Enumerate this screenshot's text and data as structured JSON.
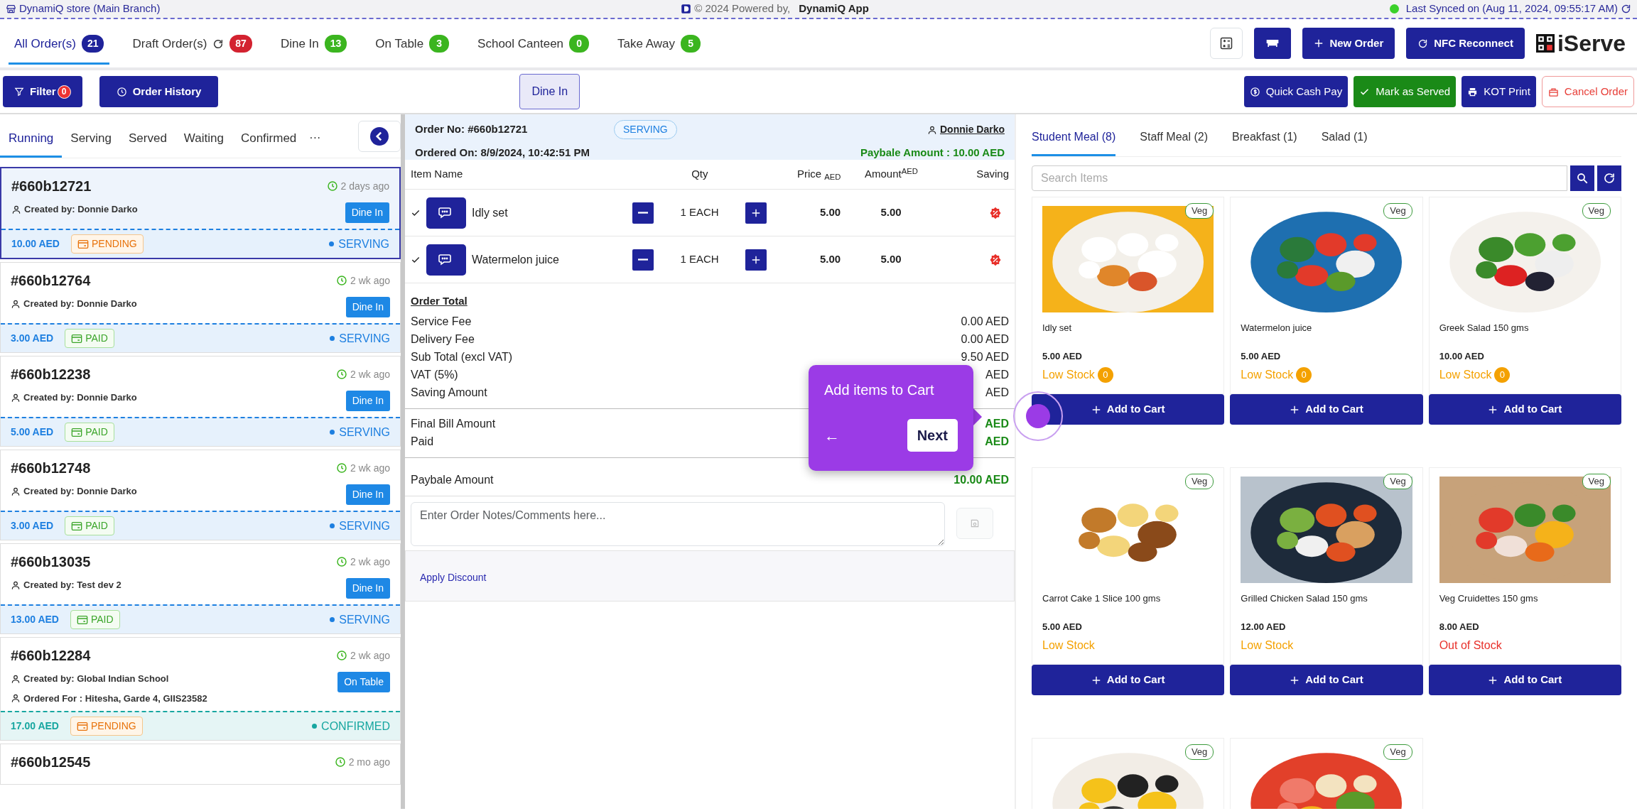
{
  "top_bar": {
    "store": "DynamiQ store (Main Branch)",
    "copyright": "© 2024 Powered by,",
    "brand": "DynamiQ App",
    "online": true,
    "sync": "Last Synced on (Aug 11, 2024, 09:55:17 AM)"
  },
  "order_tabs": [
    {
      "label": "All Order(s)",
      "count": "21",
      "color": "#1f239a",
      "selected": true
    },
    {
      "label": "Draft Order(s)",
      "refresh": true,
      "count": "87",
      "color": "#d32230",
      "selected": false
    },
    {
      "label": "Dine In",
      "count": "13",
      "color": "#3bb51f",
      "selected": false
    },
    {
      "label": "On Table",
      "count": "3",
      "color": "#3bb51f",
      "selected": false
    },
    {
      "label": "School Canteen",
      "count": "0",
      "color": "#3bb51f",
      "selected": false
    },
    {
      "label": "Take Away",
      "count": "5",
      "color": "#3bb51f",
      "selected": false
    }
  ],
  "toolbar": {
    "new_order": "New Order",
    "nfc": "NFC Reconnect",
    "logo": "iServe"
  },
  "actions": {
    "filter": "Filter",
    "filter_count": "0",
    "history": "Order History",
    "mode": "Dine In",
    "quick_pay": "Quick Cash Pay",
    "mark_served": "Mark as Served",
    "kot": "KOT Print",
    "cancel": "Cancel Order"
  },
  "status_tabs": [
    {
      "label": "Running",
      "selected": true
    },
    {
      "label": "Serving",
      "selected": false
    },
    {
      "label": "Served",
      "selected": false
    },
    {
      "label": "Waiting",
      "selected": false
    },
    {
      "label": "Confirmed",
      "selected": false
    }
  ],
  "more": "···",
  "orders": [
    {
      "id": "#660b12721",
      "time": "2 days ago",
      "created_by": "Created by: Donnie Darko",
      "type": "Dine In",
      "amount": "10.00 AED",
      "payment": "PENDING",
      "paid": false,
      "status": "SERVING",
      "color": "#1d7fe0",
      "selected": true
    },
    {
      "id": "#660b12764",
      "time": "2 wk ago",
      "created_by": "Created by: Donnie Darko",
      "type": "Dine In",
      "amount": "3.00 AED",
      "payment": "PAID",
      "paid": true,
      "status": "SERVING",
      "color": "#1d7fe0",
      "selected": false
    },
    {
      "id": "#660b12238",
      "time": "2 wk ago",
      "created_by": "Created by: Donnie Darko",
      "type": "Dine In",
      "amount": "5.00 AED",
      "payment": "PAID",
      "paid": true,
      "status": "SERVING",
      "color": "#1d7fe0",
      "selected": false
    },
    {
      "id": "#660b12748",
      "time": "2 wk ago",
      "created_by": "Created by: Donnie Darko",
      "type": "Dine In",
      "amount": "3.00 AED",
      "payment": "PAID",
      "paid": true,
      "status": "SERVING",
      "color": "#1d7fe0",
      "selected": false
    },
    {
      "id": "#660b13035",
      "time": "2 wk ago",
      "created_by": "Created by: Test dev 2",
      "type": "Dine In",
      "amount": "13.00 AED",
      "payment": "PAID",
      "paid": true,
      "status": "SERVING",
      "color": "#1d7fe0",
      "selected": false
    },
    {
      "id": "#660b12284",
      "time": "2 wk ago",
      "created_by": "Created by: Global Indian School",
      "ordered_for": "Ordered For : Hitesha, Garde 4, GIIS23582",
      "type": "On Table",
      "amount": "17.00 AED",
      "payment": "PENDING",
      "paid": false,
      "status": "CONFIRMED",
      "color": "#17a6a0",
      "selected": false
    },
    {
      "id": "#660b12545",
      "time": "2 mo ago",
      "selected": false
    }
  ],
  "order": {
    "number": "Order No: #660b12721",
    "status": "SERVING",
    "customer": "Donnie Darko",
    "ordered_on": "Ordered On: 8/9/2024, 10:42:51 PM",
    "payable": "Paybale Amount : 10.00 AED",
    "columns": [
      "Item Name",
      "Qty",
      "Price $_{AED}$",
      "Amount$^{AED}$",
      "Saving"
    ],
    "items": [
      {
        "name": "Idly set",
        "checked": true,
        "qty": "1 EACH",
        "price": "5.00",
        "amount": "5.00"
      },
      {
        "name": "Watermelon juice",
        "checked": true,
        "qty": "1 EACH",
        "price": "5.00",
        "amount": "5.00"
      }
    ],
    "total_title": "Order Total",
    "totals": [
      {
        "label": "Service Fee",
        "value": "0.00 AED",
        "kind": "plain"
      },
      {
        "label": "Delivery Fee",
        "value": "0.00 AED",
        "kind": "plain"
      },
      {
        "label": "Sub Total (excl VAT)",
        "value": "9.50 AED",
        "kind": "plain"
      },
      {
        "label": "VAT (5%)",
        "value": "AED",
        "kind": "plain"
      },
      {
        "label": "Saving Amount",
        "value": "AED",
        "kind": "plain"
      },
      {
        "label": "Final Bill Amount",
        "value": "AED",
        "kind": "green",
        "divider": true
      },
      {
        "label": "Paid",
        "value": "AED",
        "kind": "green"
      },
      {
        "label": "Paybale Amount",
        "value": "10.00 AED",
        "kind": "bold",
        "divider": true
      }
    ],
    "notes_placeholder": "Enter Order Notes/Comments here...",
    "save_disabled": true,
    "discount": "Apply Discount"
  },
  "menu_tabs": [
    {
      "label": "Student Meal (8)",
      "selected": true
    },
    {
      "label": "Staff Meal (2)",
      "selected": false
    },
    {
      "label": "Breakfast (1)",
      "selected": false
    },
    {
      "label": "Salad (1)",
      "selected": false
    }
  ],
  "search": {
    "placeholder": "Search Items"
  },
  "products": [
    {
      "badge": "Veg",
      "name": "Idly set",
      "price": "5.00 AED",
      "stock": "Low Stock",
      "color": "#f4a100",
      "stock_count": "0",
      "button": "Add to Cart"
    },
    {
      "badge": "Veg",
      "name": "Watermelon juice",
      "price": "5.00 AED",
      "stock": "Low Stock",
      "color": "#f4a100",
      "stock_count": "0",
      "button": "Add to Cart"
    },
    {
      "badge": "Veg",
      "name": "Greek Salad 150 gms",
      "price": "10.00 AED",
      "stock": "Low Stock",
      "color": "#f4a100",
      "stock_count": "0",
      "button": "Add to Cart"
    },
    {
      "badge": "Veg",
      "name": "Carrot Cake 1 Slice 100 gms",
      "price": "5.00 AED",
      "stock": "Low Stock",
      "color": "#f4a100",
      "button": "Add to Cart"
    },
    {
      "badge": "Veg",
      "name": "Grilled Chicken Salad 150 gms",
      "price": "12.00 AED",
      "stock": "Low Stock",
      "color": "#f4a100",
      "button": "Add to Cart"
    },
    {
      "badge": "Veg",
      "name": "Veg Cruidettes 150 gms",
      "price": "8.00 AED",
      "stock": "Out of Stock",
      "color": "#e8302a",
      "button": "Add to Cart"
    },
    {
      "badge": "Veg"
    },
    {
      "badge": "Veg"
    }
  ],
  "tour": {
    "text": "Add items to Cart",
    "back": "←",
    "next": "Next"
  }
}
